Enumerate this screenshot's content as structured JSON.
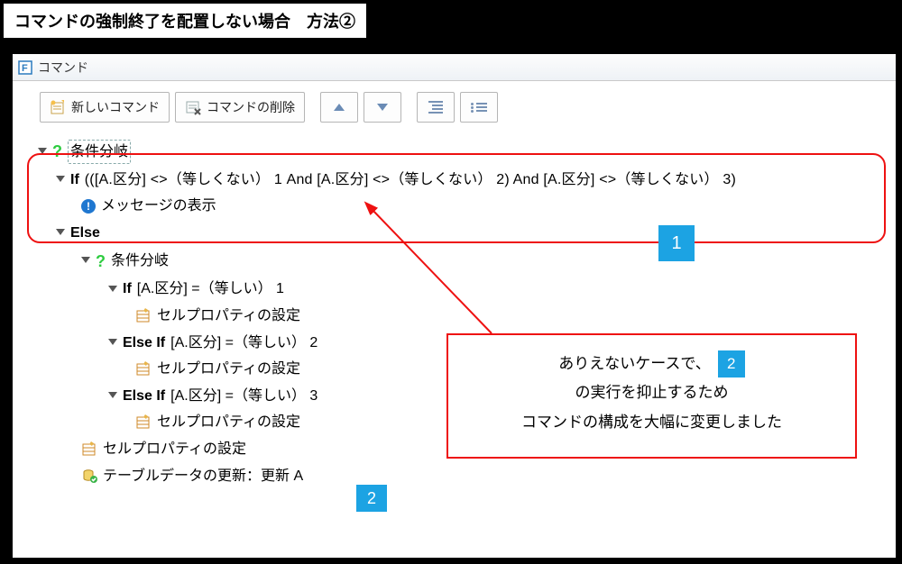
{
  "caption": "コマンドの強制終了を配置しない場合　方法②",
  "window": {
    "title": "コマンド"
  },
  "toolbar": {
    "new_label": "新しいコマンド",
    "delete_label": "コマンドの削除"
  },
  "tree": {
    "root_label": "条件分岐",
    "if_kw": "If",
    "if_cond": "(([A.区分] <>（等しくない） 1 And [A.区分] <>（等しくない） 2) And [A.区分] <>（等しくない） 3)",
    "msg_label": "メッセージの表示",
    "else_kw": "Else",
    "inner_branch": "条件分岐",
    "if2_kw": "If",
    "if2_cond": "[A.区分] =（等しい） 1",
    "cellprop": "セルプロパティの設定",
    "elseif_kw": "Else If",
    "elseif1_cond": "[A.区分] =（等しい） 2",
    "elseif2_cond": "[A.区分] =（等しい） 3",
    "update_label": "テーブルデータの更新：更新 A"
  },
  "badges": {
    "one": "1",
    "two": "2"
  },
  "callout": {
    "line1_prefix": "ありえないケースで、",
    "line2": "の実行を抑止するため",
    "line3": "コマンドの構成を大幅に変更しました"
  }
}
